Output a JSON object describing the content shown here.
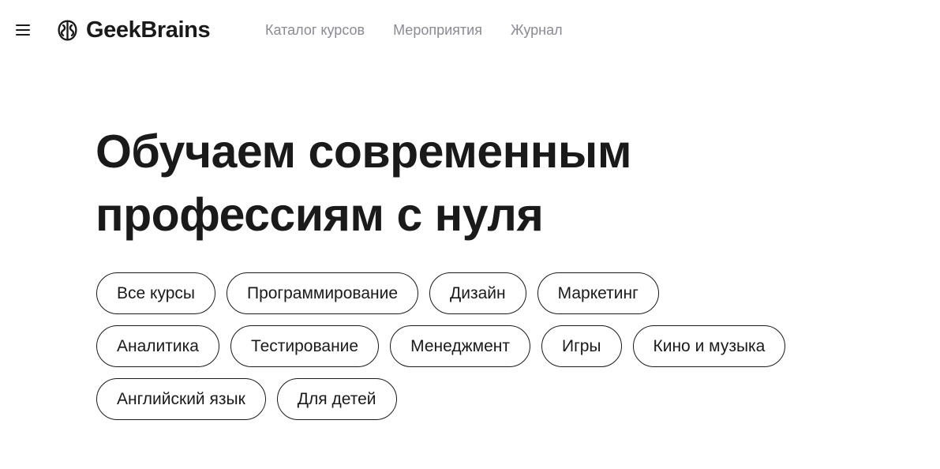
{
  "header": {
    "menu_icon": "hamburger-menu-icon",
    "logo": {
      "icon": "brain-logo-icon",
      "text": "GeekBrains"
    },
    "nav": [
      {
        "label": "Каталог курсов"
      },
      {
        "label": "Мероприятия"
      },
      {
        "label": "Журнал"
      }
    ]
  },
  "hero": {
    "title_line1": "Обучаем современным",
    "title_line2": "профессиям с нуля"
  },
  "categories": {
    "rows": [
      [
        {
          "label": "Все курсы"
        },
        {
          "label": "Программирование"
        },
        {
          "label": "Дизайн"
        },
        {
          "label": "Маркетинг"
        }
      ],
      [
        {
          "label": "Аналитика"
        },
        {
          "label": "Тестирование"
        },
        {
          "label": "Менеджмент"
        },
        {
          "label": "Игры"
        },
        {
          "label": "Кино и музыка"
        }
      ],
      [
        {
          "label": "Английский язык"
        },
        {
          "label": "Для детей"
        }
      ]
    ]
  },
  "colors": {
    "text": "#1a1a1a",
    "nav_text": "#8a8a95",
    "background": "#ffffff"
  }
}
